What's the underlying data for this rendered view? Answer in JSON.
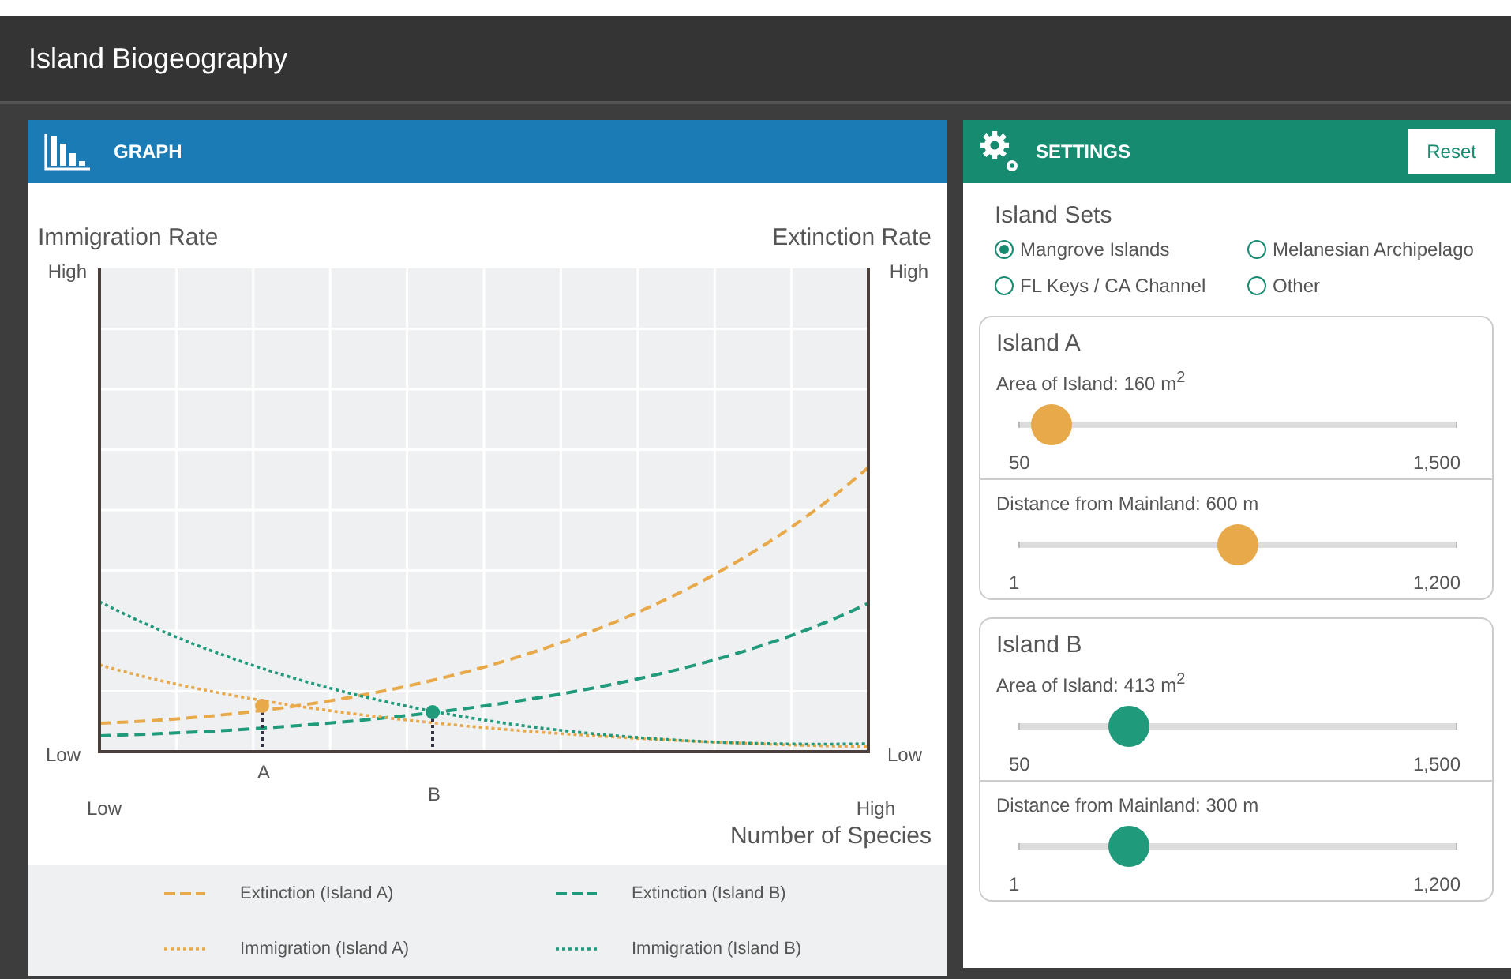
{
  "window": {
    "title": "Island Biogeography"
  },
  "graph": {
    "title": "GRAPH",
    "axes": {
      "left_title": "Immigration Rate",
      "right_title": "Extinction Rate",
      "left_high": "High",
      "right_high": "High",
      "left_low": "Low",
      "right_low": "Low",
      "x_low": "Low",
      "x_high": "High",
      "x_title": "Number of Species"
    },
    "markers": [
      {
        "label": "A",
        "color": "#e8a94a"
      },
      {
        "label": "B",
        "color": "#1f9a7a"
      }
    ],
    "legend": [
      {
        "label": "Extinction (Island A)",
        "kind": "dashed",
        "color": "#e8a94a"
      },
      {
        "label": "Extinction (Island B)",
        "kind": "dashed",
        "color": "#1f9a7a"
      },
      {
        "label": "Immigration (Island A)",
        "kind": "dotted",
        "color": "#e8a94a"
      },
      {
        "label": "Immigration (Island B)",
        "kind": "dotted",
        "color": "#1f9a7a"
      }
    ]
  },
  "settings": {
    "title": "SETTINGS",
    "reset": "Reset",
    "island_sets_title": "Island Sets",
    "island_sets": [
      {
        "label": "Mangrove Islands",
        "selected": true
      },
      {
        "label": "Melanesian Archipelago",
        "selected": false
      },
      {
        "label": "FL Keys / CA Channel",
        "selected": false
      },
      {
        "label": "Other",
        "selected": false
      }
    ],
    "islands": [
      {
        "title": "Island A",
        "color": "#e8a94a",
        "sliders": [
          {
            "label": "Area of Island: 160 m$^{2}$",
            "level": 0.076,
            "min": "50",
            "max": "1,500"
          },
          {
            "label": "Distance from Mainland: 600 m",
            "level": 0.5,
            "min": "1",
            "max": "1,200"
          }
        ]
      },
      {
        "title": "Island B",
        "color": "#1f9a7a",
        "sliders": [
          {
            "label": "Area of Island: 413 m$^{2}$",
            "level": 0.25,
            "min": "50",
            "max": "1,500"
          },
          {
            "label": "Distance from Mainland: 300 m",
            "level": 0.25,
            "min": "1",
            "max": "1,200"
          }
        ]
      }
    ]
  }
}
